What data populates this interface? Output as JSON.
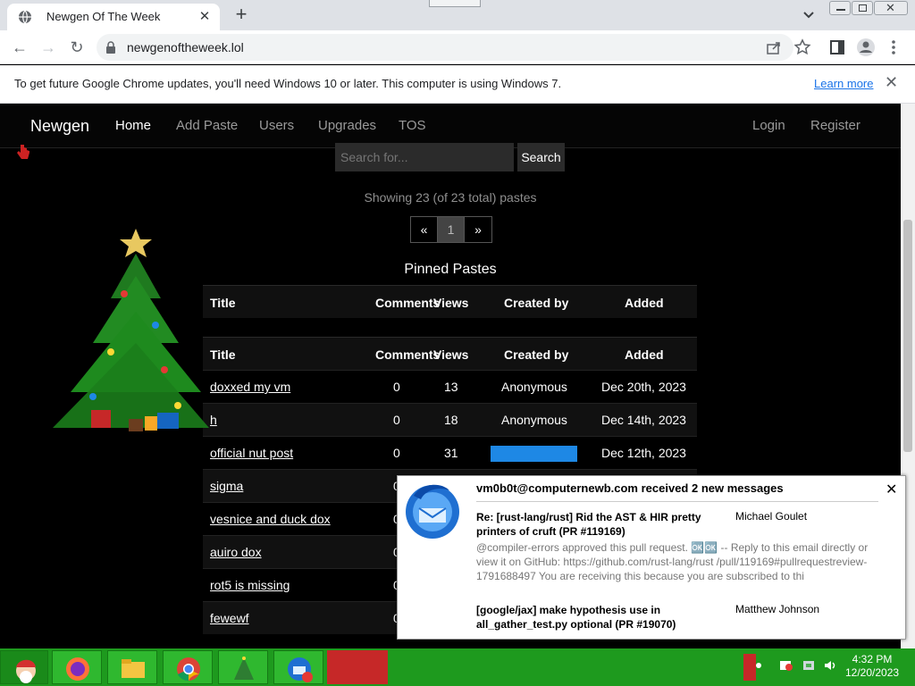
{
  "browser": {
    "tab_title": "Newgen Of The Week",
    "url": "newgenoftheweek.lol",
    "infobar_message": "To get future Google Chrome updates, you'll need Windows 10 or later. This computer is using Windows 7.",
    "infobar_link": "Learn more"
  },
  "site": {
    "brand": "Newgen",
    "nav": [
      "Home",
      "Add Paste",
      "Users",
      "Upgrades",
      "TOS"
    ],
    "nav_right": [
      "Login",
      "Register"
    ],
    "search_placeholder": "Search for...",
    "search_button": "Search",
    "showing": "Showing 23 (of 23 total) pastes",
    "pager": [
      "«",
      "1",
      "»"
    ],
    "pinned_title": "Pinned Pastes",
    "columns": [
      "Title",
      "Comments",
      "Views",
      "Created by",
      "Added"
    ],
    "rows": [
      {
        "title": "doxxed my vm",
        "comments": "0",
        "views": "13",
        "created_by": "Anonymous",
        "added": "Dec 20th, 2023"
      },
      {
        "title": "h",
        "comments": "0",
        "views": "18",
        "created_by": "Anonymous",
        "added": "Dec 14th, 2023"
      },
      {
        "title": "official nut post",
        "comments": "0",
        "views": "31",
        "created_by": "",
        "added": "Dec 12th, 2023"
      },
      {
        "title": "sigma",
        "comments": "0",
        "views": "",
        "created_by": "",
        "added": ""
      },
      {
        "title": "vesnice and duck dox",
        "comments": "0",
        "views": "",
        "created_by": "",
        "added": ""
      },
      {
        "title": "auiro dox",
        "comments": "0",
        "views": "",
        "created_by": "",
        "added": ""
      },
      {
        "title": "rot5 is missing",
        "comments": "0",
        "views": "",
        "created_by": "",
        "added": ""
      },
      {
        "title": "fewewf",
        "comments": "0",
        "views": "",
        "created_by": "",
        "added": ""
      }
    ]
  },
  "notification": {
    "header": "vm0b0t@computernewb.com received 2 new messages",
    "messages": [
      {
        "subject": "Re: [rust-lang/rust] Rid the AST & HIR pretty printers of cruft (PR #119169)",
        "from": "Michael Goulet",
        "body": "@compiler-errors approved this pull request. 🆗🆗 -- Reply to this email directly or view it on GitHub: https://github.com/rust-lang/rust /pull/119169#pullrequestreview-1791688497 You are receiving this because you are subscribed to thi"
      },
      {
        "subject": "[google/jax] make hypothesis use in all_gather_test.py optional (PR #19070)",
        "from": "Matthew Johnson",
        "body": ""
      }
    ]
  },
  "taskbar": {
    "clock_time": "4:32 PM",
    "clock_date": "12/20/2023"
  },
  "colors": {
    "taskbar": "#1e9a1e",
    "link": "#1a73e8",
    "page_bg": "#000000"
  }
}
